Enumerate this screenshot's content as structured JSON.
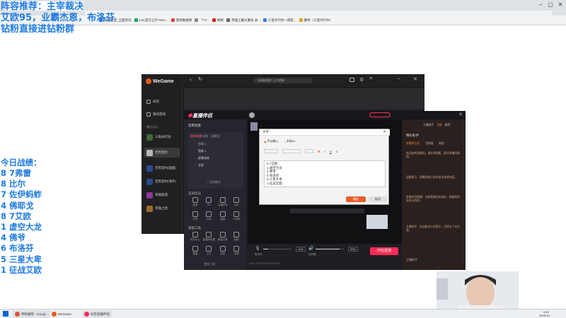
{
  "overlay": {
    "lines": [
      "阵容推荐：主宰裁决",
      "艾欧95，业霸杰恩，布洛芬",
      "钻粉直接进钻粉群"
    ],
    "record_title": "今日战绩：",
    "records": [
      "8 7弗雷",
      "8 比尔",
      "7 佐伊蚂蚱",
      "4 佛耶戈",
      "8 7艾欧",
      "1 虚空大龙",
      "4 佛爷",
      "6 布洛芬",
      "5 三星大卑",
      "1 征战艾欧"
    ]
  },
  "browser": {
    "bookmarks": [
      "英雄联盟_全面资讯",
      "LOL官方之外 NGA...",
      "游戏数据库",
      "「YY...",
      "网易",
      "英雄之翼大厦站 录...",
      "三星外行你一网友...",
      "最终（三星外行中）"
    ]
  },
  "wegame": {
    "logo": "WeGame",
    "search_placeholder": "《英雄联盟》正在更新",
    "nav": [
      "商店",
      "我的游戏"
    ],
    "section": "最近在玩",
    "games": [
      "三角洲行动",
      "无畏契约",
      "无畏契约(国服)",
      "无畏契约(海外)",
      "英雄联盟",
      "英雄之地"
    ],
    "accent_color": "#e25a1c"
  },
  "zhibo": {
    "logo": "直播伴侣",
    "scene_dropdown": "常用场景",
    "scene_tabs": [
      "我的场景",
      "场景",
      "场景组"
    ],
    "scene_items": [
      "主场 1",
      "图像 1",
      "屏幕录制",
      "全屏"
    ],
    "add_scene": "+ 添加素材",
    "section_interact": "互动玩法",
    "interact_items": [
      "连麦",
      "PK",
      "主播任务",
      "互动",
      "礼物",
      "互动",
      "福袋",
      "小游戏"
    ],
    "section_tools": "基础工具",
    "tool_items": [
      "任务中心",
      "直播间设置",
      "屏幕共享",
      "视频",
      "直播",
      "文字",
      "相机",
      "设置"
    ],
    "more_tools": "更多工具",
    "mic_value": "18%",
    "speaker_value": "85%",
    "mic_label": "麦克风",
    "speaker_label": "扬声器",
    "start_button": "开始直播",
    "status_text": "CPU 27%  内存 36%  FPS 60",
    "right_tabs": [
      "主播助手",
      "功能",
      "推荐"
    ],
    "right_title": "精彩助手",
    "right_subtabs": [
      "直播间互动",
      "活跃度",
      "粉丝"
    ],
    "right_msgs": [
      "欢迎来到直播间，请文明观看，遵守直播间规则。",
      "温馨提示：直播间禁止发布违法违规内容。",
      "直播伴侣提醒：当前直播状态良好，感谢您的支持与陪伴。",
      "主播助手：欢迎新进入的观众，记得点个关注哦。"
    ],
    "right_bottom": "主播助手"
  },
  "dialog": {
    "title": "文字",
    "radio_options": [
      "手动输入",
      "本地txt"
    ],
    "editor_lines": [
      "6 7艾欧",
      "1 虚空大龙",
      "4 佛爷",
      "6 布洛芬",
      "5 三星大卑",
      "1 征战艾欧"
    ],
    "ok": "确定",
    "cancel": "取消"
  },
  "taskbar": {
    "items": [
      "阵粉推荐 - Googl...",
      "WeGame",
      "抖音直播伴侣"
    ],
    "time": "9:00",
    "date": "2026/1/1"
  }
}
